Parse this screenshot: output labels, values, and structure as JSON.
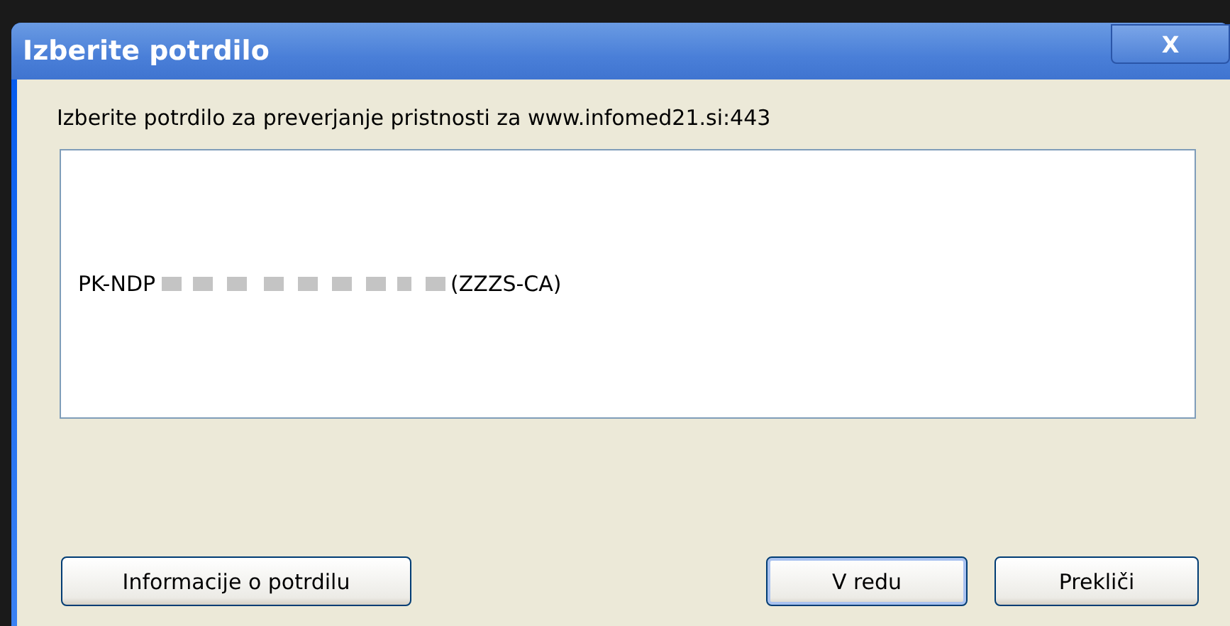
{
  "window": {
    "title": "Izberite potrdilo",
    "close": "X"
  },
  "prompt": "Izberite potrdilo za preverjanje pristnosti za www.infomed21.si:443",
  "certificates": [
    {
      "prefix": "PK-NDP",
      "issuer": "(ZZZS-CA)",
      "redacted": true
    }
  ],
  "buttons": [
    {
      "label": "Informacije o potrdilu",
      "default": false
    },
    {
      "label": "V redu",
      "default": true
    },
    {
      "label": "Prekliči",
      "default": false
    }
  ]
}
